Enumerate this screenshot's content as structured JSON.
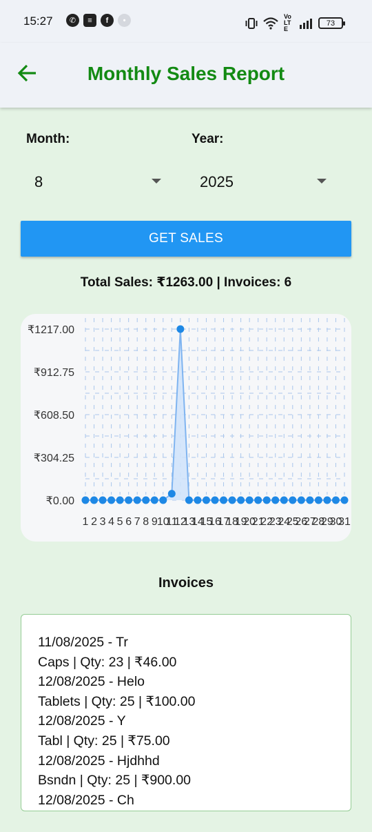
{
  "status_bar": {
    "time": "15:27",
    "battery": "73",
    "network": "Vo LTE",
    "left_icons": [
      "whatsapp-icon",
      "notes-icon",
      "facebook-icon",
      "app-icon"
    ],
    "right_icons": [
      "vibrate-icon",
      "wifi-icon",
      "signal-icon",
      "battery-icon"
    ]
  },
  "header": {
    "title": "Monthly Sales Report",
    "back_icon": "arrow-left-icon"
  },
  "filters": {
    "month_label": "Month:",
    "month_value": "8",
    "year_label": "Year:",
    "year_value": "2025"
  },
  "actions": {
    "get_sales_label": "GET SALES"
  },
  "summary": {
    "text": "Total Sales: ₹1263.00 | Invoices: 6"
  },
  "colors": {
    "accent": "#2196f3",
    "title": "#138a13",
    "background": "#e4f3e4",
    "point": "#1e88e5",
    "area": "#cfe3fb"
  },
  "chart_data": {
    "type": "line",
    "x": [
      1,
      2,
      3,
      4,
      5,
      6,
      7,
      8,
      9,
      10,
      11,
      12,
      13,
      14,
      15,
      16,
      17,
      18,
      19,
      20,
      21,
      22,
      23,
      24,
      25,
      26,
      27,
      28,
      29,
      30,
      31
    ],
    "x_tick_labels": [
      "1",
      "2",
      "3",
      "4",
      "5",
      "6",
      "7",
      "8",
      "9",
      "10",
      "11",
      "12",
      "13",
      "14",
      "15",
      "16",
      "17",
      "18",
      "19",
      "20",
      "21",
      "22",
      "23",
      "24",
      "25",
      "26",
      "27",
      "28",
      "29",
      "30",
      "31"
    ],
    "values": [
      0,
      0,
      0,
      0,
      0,
      0,
      0,
      0,
      0,
      0,
      46,
      1217,
      0,
      0,
      0,
      0,
      0,
      0,
      0,
      0,
      0,
      0,
      0,
      0,
      0,
      0,
      0,
      0,
      0,
      0,
      0
    ],
    "y_tick_labels": [
      "₹1217.00",
      "₹912.75",
      "₹608.50",
      "₹304.25",
      "₹0.00"
    ],
    "y_ticks": [
      1217,
      912.75,
      608.5,
      304.25,
      0
    ],
    "ylim": [
      0,
      1217
    ],
    "area_fill": true,
    "grid": true
  },
  "invoices": {
    "title": "Invoices",
    "lines": [
      "11/08/2025 - Tr",
      "Caps | Qty: 23 | ₹46.00",
      "12/08/2025 - Helo",
      "Tablets  | Qty: 25 | ₹100.00",
      "12/08/2025 - Y",
      "Tabl | Qty: 25 | ₹75.00",
      "12/08/2025 - Hjdhhd",
      "Bsndn | Qty: 25 | ₹900.00",
      "12/08/2025 - Ch"
    ]
  }
}
